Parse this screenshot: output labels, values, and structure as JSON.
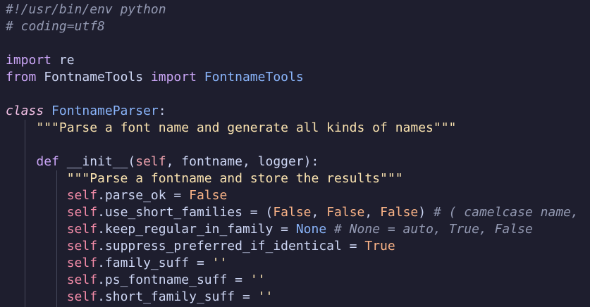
{
  "editor": {
    "lines": [
      {
        "tokens": [
          {
            "t": "#!/usr/bin/env python",
            "c": "comment"
          }
        ]
      },
      {
        "tokens": [
          {
            "t": "# coding=utf8",
            "c": "comment"
          }
        ]
      },
      {
        "tokens": []
      },
      {
        "tokens": [
          {
            "t": "import",
            "c": "keyword"
          },
          {
            "t": " re",
            "c": "text"
          }
        ]
      },
      {
        "tokens": [
          {
            "t": "from",
            "c": "keyword"
          },
          {
            "t": " FontnameTools ",
            "c": "text"
          },
          {
            "t": "import",
            "c": "keyword"
          },
          {
            "t": " FontnameTools",
            "c": "class"
          }
        ]
      },
      {
        "tokens": []
      },
      {
        "tokens": [
          {
            "t": "class",
            "c": "italic-keyword"
          },
          {
            "t": " FontnameParser",
            "c": "class"
          },
          {
            "t": ":",
            "c": "text"
          }
        ]
      },
      {
        "tokens": [
          {
            "t": "    ",
            "c": "text"
          },
          {
            "t": "\"\"\"Parse a font name and generate all kinds of names\"\"\"",
            "c": "string"
          }
        ]
      },
      {
        "tokens": []
      },
      {
        "tokens": [
          {
            "t": "    ",
            "c": "text"
          },
          {
            "t": "def",
            "c": "keyword"
          },
          {
            "t": " __init__(",
            "c": "text"
          },
          {
            "t": "self",
            "c": "param"
          },
          {
            "t": ", fontname, logger):",
            "c": "text"
          }
        ]
      },
      {
        "tokens": [
          {
            "t": "        ",
            "c": "text"
          },
          {
            "t": "\"\"\"Parse a fontname and store the results\"\"\"",
            "c": "string"
          }
        ]
      },
      {
        "tokens": [
          {
            "t": "        ",
            "c": "text"
          },
          {
            "t": "self",
            "c": "self"
          },
          {
            "t": ".parse_ok = ",
            "c": "text"
          },
          {
            "t": "False",
            "c": "bool"
          }
        ]
      },
      {
        "tokens": [
          {
            "t": "        ",
            "c": "text"
          },
          {
            "t": "self",
            "c": "self"
          },
          {
            "t": ".use_short_families = (",
            "c": "text"
          },
          {
            "t": "False",
            "c": "bool"
          },
          {
            "t": ", ",
            "c": "text"
          },
          {
            "t": "False",
            "c": "bool"
          },
          {
            "t": ", ",
            "c": "text"
          },
          {
            "t": "False",
            "c": "bool"
          },
          {
            "t": ") ",
            "c": "text"
          },
          {
            "t": "# ( camelcase name, ",
            "c": "comment"
          }
        ]
      },
      {
        "tokens": [
          {
            "t": "        ",
            "c": "text"
          },
          {
            "t": "self",
            "c": "self"
          },
          {
            "t": ".keep_regular_in_family = ",
            "c": "text"
          },
          {
            "t": "None",
            "c": "none"
          },
          {
            "t": " # None = auto, True, False",
            "c": "comment"
          }
        ]
      },
      {
        "tokens": [
          {
            "t": "        ",
            "c": "text"
          },
          {
            "t": "self",
            "c": "self"
          },
          {
            "t": ".suppress_preferred_if_identical = ",
            "c": "text"
          },
          {
            "t": "True",
            "c": "bool"
          }
        ]
      },
      {
        "tokens": [
          {
            "t": "        ",
            "c": "text"
          },
          {
            "t": "self",
            "c": "self"
          },
          {
            "t": ".family_suff = ",
            "c": "text"
          },
          {
            "t": "''",
            "c": "string"
          }
        ]
      },
      {
        "tokens": [
          {
            "t": "        ",
            "c": "text"
          },
          {
            "t": "self",
            "c": "self"
          },
          {
            "t": ".ps_fontname_suff = ",
            "c": "text"
          },
          {
            "t": "''",
            "c": "string"
          }
        ]
      },
      {
        "tokens": [
          {
            "t": "        ",
            "c": "text"
          },
          {
            "t": "self",
            "c": "self"
          },
          {
            "t": ".short_family_suff = ",
            "c": "text"
          },
          {
            "t": "''",
            "c": "string"
          }
        ]
      }
    ]
  }
}
